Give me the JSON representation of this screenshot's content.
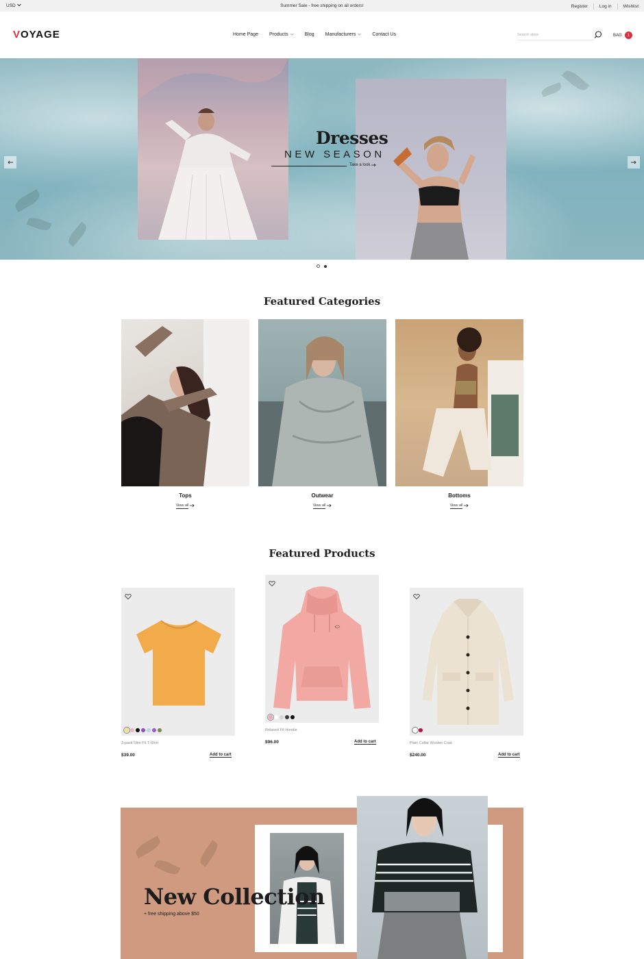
{
  "topbar": {
    "currency": "USD",
    "promo": "Summer Sale - free shipping on all orders!",
    "links": [
      "Register",
      "Log in",
      "Wishlist"
    ]
  },
  "header": {
    "logo_first": "V",
    "logo_rest": "OYAGE",
    "nav": [
      {
        "label": "Home Page",
        "dropdown": false
      },
      {
        "label": "Products",
        "dropdown": true
      },
      {
        "label": "Blog",
        "dropdown": false
      },
      {
        "label": "Manufacturers",
        "dropdown": true
      },
      {
        "label": "Contact Us",
        "dropdown": false
      }
    ],
    "search_placeholder": "Search store",
    "bag_label": "BAG",
    "bag_count": "1"
  },
  "hero": {
    "title": "Dresses",
    "subtitle": "NEW SEASON",
    "link": "Take a look",
    "slides": 2,
    "active_slide": 1
  },
  "categories": {
    "title": "Featured Categories",
    "items": [
      {
        "name": "Tops",
        "link": "View all"
      },
      {
        "name": "Outwear",
        "link": "View all"
      },
      {
        "name": "Bottoms",
        "link": "View all"
      }
    ]
  },
  "products": {
    "title": "Featured Products",
    "items": [
      {
        "name": "3-pack Slim Fit T-Shirt",
        "price": "$39.00",
        "cta": "Add to cart",
        "swatches": [
          "#f3e28b",
          "#f4b6c2",
          "#111111",
          "#8e4fc4",
          "#b9d3ee",
          "#9c5bd1",
          "#7a8a55"
        ]
      },
      {
        "name": "Relaxed Fit Hoodie",
        "price": "$96.00",
        "cta": "Add to cart",
        "swatches": [
          "#f0a7b3",
          "#ffffff",
          "#d5d5d5",
          "#3a3a3a",
          "#111111"
        ]
      },
      {
        "name": "Plain Collar Woolen Coat",
        "price": "$240.00",
        "cta": "Add to cart",
        "swatches": [
          "#ffffff",
          "#b0174a"
        ]
      }
    ]
  },
  "collection": {
    "title": "New Collection",
    "subtitle": "+ free shipping above $50"
  },
  "colors": {
    "accent": "#d8303f",
    "collection_bg": "#cf9a80"
  }
}
